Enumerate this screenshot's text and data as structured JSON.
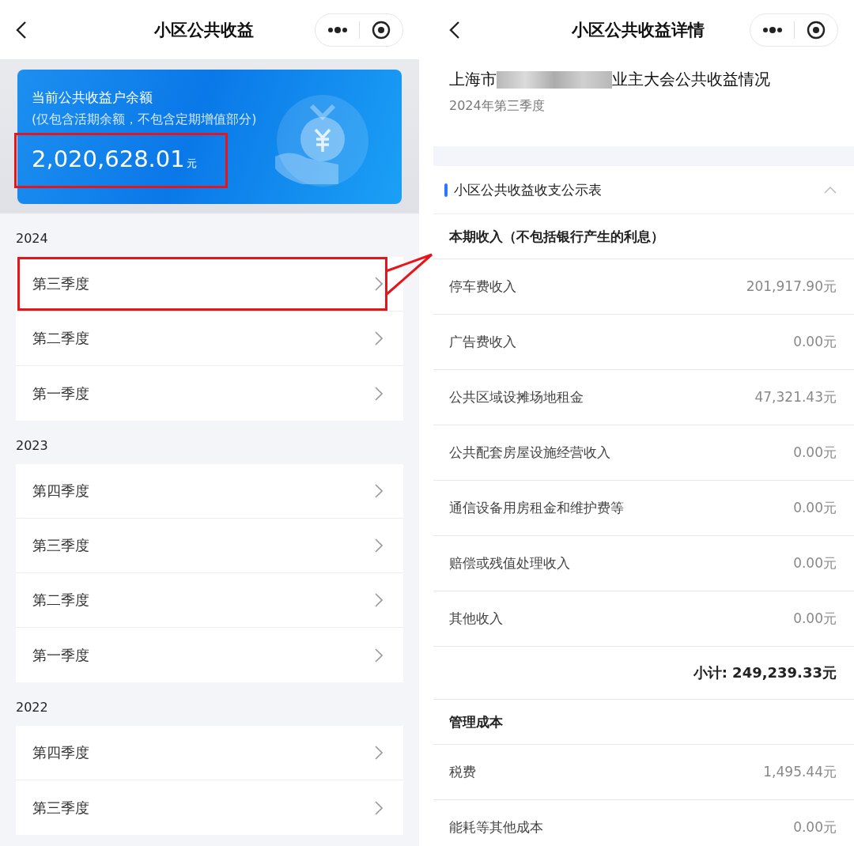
{
  "left": {
    "nav": {
      "title": "小区公共收益"
    },
    "balance": {
      "label": "当前公共收益户余额",
      "note": "(仅包含活期余额，不包含定期增值部分)",
      "amount": "2,020,628.01",
      "unit": "元",
      "highlighted": true
    },
    "years": [
      {
        "year": "2024",
        "quarters": [
          {
            "label": "第三季度",
            "highlighted": true
          },
          {
            "label": "第二季度",
            "highlighted": false
          },
          {
            "label": "第一季度",
            "highlighted": false
          }
        ]
      },
      {
        "year": "2023",
        "quarters": [
          {
            "label": "第四季度",
            "highlighted": false
          },
          {
            "label": "第三季度",
            "highlighted": false
          },
          {
            "label": "第二季度",
            "highlighted": false
          },
          {
            "label": "第一季度",
            "highlighted": false
          }
        ]
      },
      {
        "year": "2022",
        "quarters": [
          {
            "label": "第四季度",
            "highlighted": false
          },
          {
            "label": "第三季度",
            "highlighted": false
          }
        ]
      }
    ]
  },
  "right": {
    "nav": {
      "title": "小区公共收益详情"
    },
    "report": {
      "title_start": "上海市",
      "title_end": "业主大会公共收益情况",
      "period": "2024年第三季度"
    },
    "section": {
      "title": "小区公共收益收支公示表",
      "expanded": true
    },
    "groups": [
      {
        "heading": "本期收入（不包括银行产生的利息）",
        "rows": [
          {
            "name": "停车费收入",
            "amount": "201,917.90元"
          },
          {
            "name": "广告费收入",
            "amount": "0.00元"
          },
          {
            "name": "公共区域设摊场地租金",
            "amount": "47,321.43元"
          },
          {
            "name": "公共配套房屋设施经营收入",
            "amount": "0.00元"
          },
          {
            "name": "通信设备用房租金和维护费等",
            "amount": "0.00元"
          },
          {
            "name": "赔偿或残值处理收入",
            "amount": "0.00元"
          },
          {
            "name": "其他收入",
            "amount": "0.00元"
          }
        ],
        "subtotal": "小计: 249,239.33元"
      },
      {
        "heading": "管理成本",
        "rows": [
          {
            "name": "税费",
            "amount": "1,495.44元"
          },
          {
            "name": "能耗等其他成本",
            "amount": "0.00元"
          }
        ]
      }
    ]
  }
}
